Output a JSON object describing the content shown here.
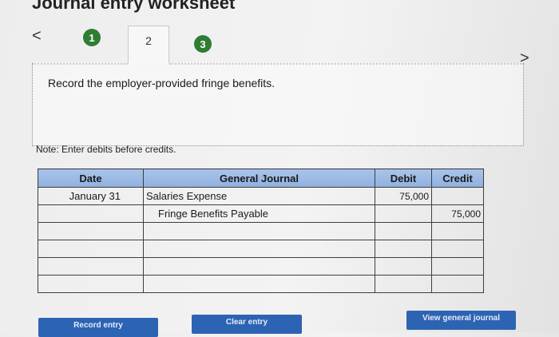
{
  "header": {
    "title": "Journal entry worksheet"
  },
  "nav": {
    "prev_glyph": "<",
    "next_glyph": ">"
  },
  "steps": [
    {
      "label": "1",
      "state": "done"
    },
    {
      "label": "2",
      "state": "current"
    },
    {
      "label": "3",
      "state": "todo"
    }
  ],
  "instruction": "Record the employer-provided fringe benefits.",
  "note": "Note: Enter debits before credits.",
  "table": {
    "headers": {
      "date": "Date",
      "account": "General Journal",
      "debit": "Debit",
      "credit": "Credit"
    },
    "rows": [
      {
        "date": "January 31",
        "account": "Salaries Expense",
        "debit": "75,000",
        "credit": ""
      },
      {
        "date": "",
        "account": "Fringe Benefits Payable",
        "debit": "",
        "credit": "75,000"
      },
      {
        "date": "",
        "account": "",
        "debit": "",
        "credit": ""
      },
      {
        "date": "",
        "account": "",
        "debit": "",
        "credit": ""
      },
      {
        "date": "",
        "account": "",
        "debit": "",
        "credit": ""
      },
      {
        "date": "",
        "account": "",
        "debit": "",
        "credit": ""
      }
    ]
  },
  "buttons": {
    "record": "Record entry",
    "clear": "Clear entry",
    "view": "View general journal"
  },
  "colors": {
    "step_green": "#2e7d32",
    "header_blue": "#a9c4ea",
    "button_blue": "#2d63b3"
  }
}
